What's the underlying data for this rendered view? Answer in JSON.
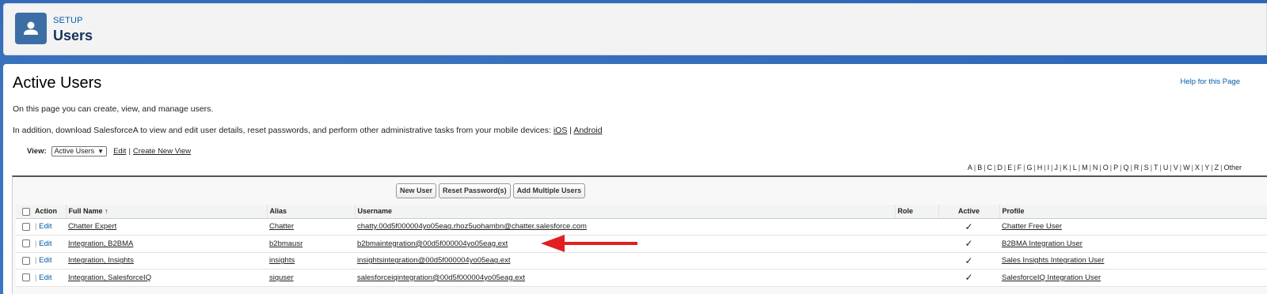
{
  "header": {
    "section_label": "SETUP",
    "title": "Users"
  },
  "page": {
    "title": "Active Users",
    "help_link": "Help for this Page",
    "description1": "On this page you can create, view, and manage users.",
    "description2_prefix": "In addition, download SalesforceA to view and edit user details, reset passwords, and perform other administrative tasks from your mobile devices: ",
    "ios_link": "iOS",
    "description2_sep": " | ",
    "android_link": "Android"
  },
  "view": {
    "label": "View:",
    "selected": "Active Users",
    "edit_link": "Edit",
    "separator": "|",
    "create_link": "Create New View"
  },
  "alphabet": [
    "A",
    "B",
    "C",
    "D",
    "E",
    "F",
    "G",
    "H",
    "I",
    "J",
    "K",
    "L",
    "M",
    "N",
    "O",
    "P",
    "Q",
    "R",
    "S",
    "T",
    "U",
    "V",
    "W",
    "X",
    "Y",
    "Z",
    "Other"
  ],
  "buttons": {
    "new_user": "New User",
    "reset_password": "Reset Password(s)",
    "add_multiple": "Add Multiple Users"
  },
  "table": {
    "columns": {
      "action": "Action",
      "full_name": "Full Name",
      "sort_indicator": "↑",
      "alias": "Alias",
      "username": "Username",
      "role": "Role",
      "active": "Active",
      "profile": "Profile"
    },
    "edit_label": "Edit",
    "action_sep": "|",
    "rows": [
      {
        "full_name": "Chatter Expert",
        "alias": "Chatter",
        "username": "chatty.00d5f000004yo05eag.rhoz5uohambn@chatter.salesforce.com",
        "role": "",
        "active": "✓",
        "profile": "Chatter Free User"
      },
      {
        "full_name": "Integration, B2BMA",
        "alias": "b2bmausr",
        "username": "b2bmaintegration@00d5f000004yo05eag.ext",
        "role": "",
        "active": "✓",
        "profile": "B2BMA Integration User"
      },
      {
        "full_name": "Integration, Insights",
        "alias": "insights",
        "username": "insightsintegration@00d5f000004yo05eag.ext",
        "role": "",
        "active": "✓",
        "profile": "Sales Insights Integration User"
      },
      {
        "full_name": "Integration, SalesforceIQ",
        "alias": "siquser",
        "username": "salesforceiqintegration@00d5f000004yo05eag.ext",
        "role": "",
        "active": "✓",
        "profile": "SalesforceIQ Integration User"
      }
    ]
  },
  "colors": {
    "annotation_arrow": "#e02020",
    "link": "#015ba7",
    "header_icon_bg": "#3c6ea6",
    "background": "#2b67b5"
  },
  "icons": {
    "header": "user-icon",
    "annotation": "red-arrow-icon"
  }
}
